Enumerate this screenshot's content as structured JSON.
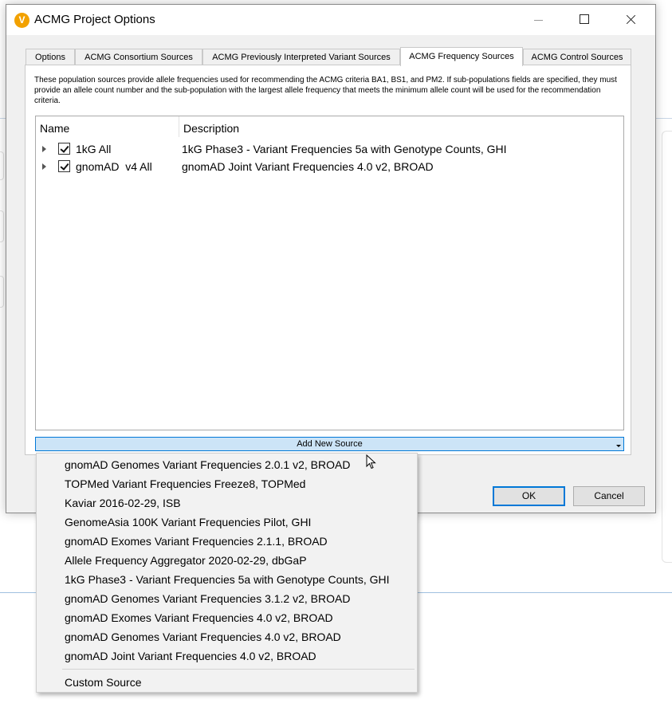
{
  "window": {
    "title": "ACMG Project Options",
    "accent_color": "#0078d7"
  },
  "tabs": [
    {
      "label": "Options"
    },
    {
      "label": "ACMG Consortium Sources"
    },
    {
      "label": "ACMG Previously Interpreted Variant Sources"
    },
    {
      "label": "ACMG Frequency Sources",
      "active": true
    },
    {
      "label": "ACMG Control Sources"
    }
  ],
  "panel": {
    "info_text": "These population sources provide allele frequencies used for recommending the ACMG criteria BA1, BS1, and PM2. If sub-populations fields are specified, they must provide an allele count number and the sub-population with the largest allele frequency that meets the minimum allele count will be used for the recommendation criteria.",
    "columns": {
      "name": "Name",
      "description": "Description"
    },
    "rows": [
      {
        "name": "1kG All",
        "description": "1kG Phase3 - Variant Frequencies 5a with Genotype Counts, GHI",
        "checked": true
      },
      {
        "name": "gnomAD  v4 All",
        "description": "gnomAD Joint Variant Frequencies 4.0 v2, BROAD",
        "checked": true
      }
    ],
    "add_button_label": "Add New Source"
  },
  "buttons": {
    "ok": "OK",
    "cancel": "Cancel"
  },
  "dropdown": {
    "items": [
      "gnomAD Genomes Variant Frequencies 2.0.1 v2, BROAD",
      "TOPMed Variant Frequencies Freeze8, TOPMed",
      "Kaviar 2016-02-29, ISB",
      "GenomeAsia 100K Variant Frequencies Pilot, GHI",
      "gnomAD Exomes Variant Frequencies 2.1.1, BROAD",
      "Allele Frequency Aggregator 2020-02-29, dbGaP",
      "1kG Phase3 - Variant Frequencies 5a with Genotype Counts, GHI",
      "gnomAD Genomes Variant Frequencies 3.1.2 v2, BROAD",
      "gnomAD Exomes Variant Frequencies 4.0 v2, BROAD",
      "gnomAD Genomes Variant Frequencies 4.0 v2, BROAD",
      "gnomAD Joint Variant Frequencies 4.0 v2, BROAD"
    ],
    "custom_item": "Custom Source"
  }
}
